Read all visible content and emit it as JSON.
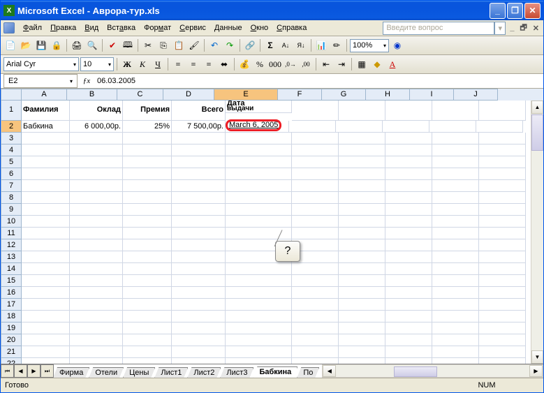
{
  "title": "Microsoft Excel - Аврора-тур.xls",
  "menu": {
    "file": "Файл",
    "edit": "Правка",
    "view": "Вид",
    "insert": "Вставка",
    "format": "Формат",
    "tools": "Сервис",
    "data": "Данные",
    "window": "Окно",
    "help": "Справка",
    "helpPlaceholder": "Введите вопрос"
  },
  "toolbar": {
    "zoom": "100%"
  },
  "format": {
    "fontName": "Arial Cyr",
    "fontSize": "10",
    "bold": "Ж",
    "italic": "К",
    "underline": "Ч"
  },
  "namebox": {
    "ref": "E2",
    "formula": "06.03.2005"
  },
  "headers": {
    "cols": [
      "A",
      "B",
      "C",
      "D",
      "E",
      "F",
      "G",
      "H",
      "I",
      "J"
    ],
    "selCol": "E",
    "selRow": "2"
  },
  "data": {
    "row1": {
      "A": "Фамилия",
      "B": "Оклад",
      "C": "Премия",
      "D": "Всего",
      "E1": "Дата",
      "E2": "выдачи"
    },
    "row2": {
      "A": "Бабкина",
      "B": "6 000,00р.",
      "C": "25%",
      "D": "7 500,00р.",
      "E": "March 6, 2005"
    }
  },
  "callout": "?",
  "tabs": {
    "nav": [
      "⏮",
      "◀",
      "▶",
      "⏭"
    ],
    "items": [
      "Фирма",
      "Отели",
      "Цены",
      "Лист1",
      "Лист2",
      "Лист3",
      "Бабкина",
      "По"
    ],
    "active": "Бабкина"
  },
  "status": {
    "ready": "Готово",
    "num": "NUM"
  }
}
